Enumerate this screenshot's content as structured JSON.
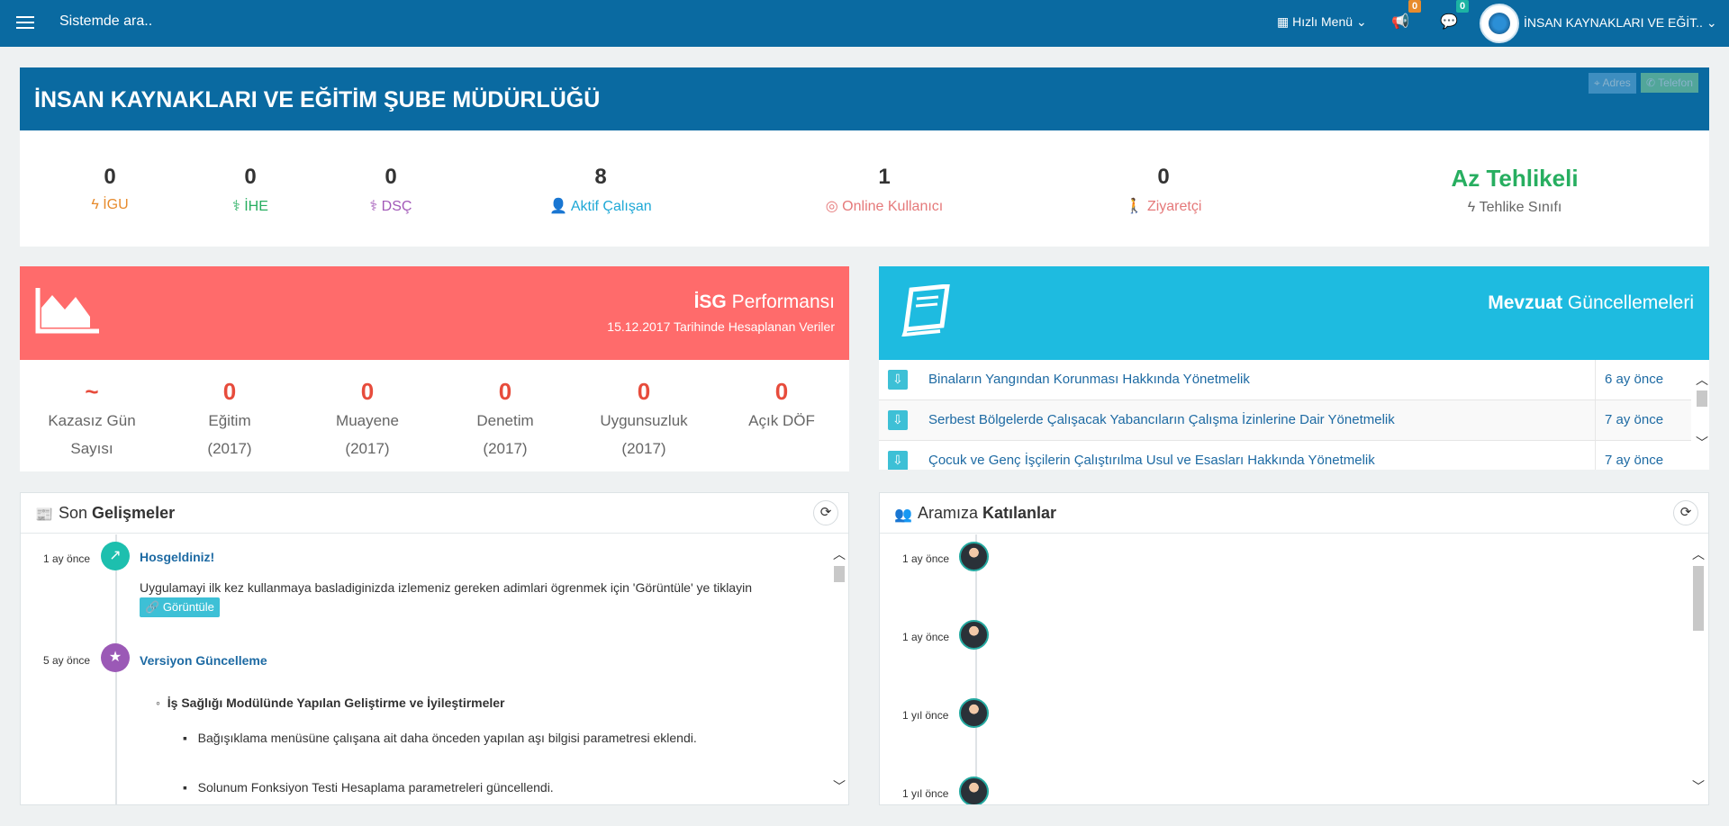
{
  "topbar": {
    "search_placeholder": "Sistemde ara..",
    "quick_menu": "Hızlı Menü",
    "notifications_count": "0",
    "messages_count": "0",
    "org_name": "İNSAN KAYNAKLARI VE EĞİT.."
  },
  "dept": {
    "title": "İNSAN KAYNAKLARI VE EĞİTİM ŞUBE MÜDÜRLÜĞÜ",
    "address_label": "Adres",
    "phone_label": "Telefon",
    "stats": [
      {
        "value": "0",
        "label": "İGU",
        "color": "#e78b2d"
      },
      {
        "value": "0",
        "label": "İHE",
        "color": "#27ae60"
      },
      {
        "value": "0",
        "label": "DSÇ",
        "color": "#a259b8"
      },
      {
        "value": "8",
        "label": "Aktif Çalışan",
        "color": "#1ea8d6"
      },
      {
        "value": "1",
        "label": "Online Kullanıcı",
        "color": "#e5797a"
      },
      {
        "value": "0",
        "label": "Ziyaretçi",
        "color": "#e5797a"
      },
      {
        "value": "Az Tehlikeli",
        "label": "Tehlike Sınıfı",
        "color": "#27ae60"
      }
    ]
  },
  "isg": {
    "title_bold": "İSG",
    "title_rest": " Performansı",
    "subtitle": "15.12.2017 Tarihinde Hesaplanan Veriler",
    "metrics": [
      {
        "value": "~",
        "line1": "Kazasız Gün",
        "line2": "Sayısı"
      },
      {
        "value": "0",
        "line1": "Eğitim",
        "line2": "(2017)"
      },
      {
        "value": "0",
        "line1": "Muayene",
        "line2": "(2017)"
      },
      {
        "value": "0",
        "line1": "Denetim",
        "line2": "(2017)"
      },
      {
        "value": "0",
        "line1": "Uygunsuzluk",
        "line2": "(2017)"
      },
      {
        "value": "0",
        "line1": "Açık DÖF",
        "line2": ""
      }
    ]
  },
  "mevzuat": {
    "title_bold": "Mevzuat",
    "title_rest": " Güncellemeleri",
    "rows": [
      {
        "name": "Binaların Yangından Korunması Hakkında Yönetmelik",
        "time": "6 ay önce"
      },
      {
        "name": "Serbest Bölgelerde Çalışacak Yabancıların Çalışma İzinlerine Dair Yönetmelik",
        "time": "7 ay önce"
      },
      {
        "name": "Çocuk ve Genç İşçilerin Çalıştırılma Usul ve Esasları Hakkında Yönetmelik",
        "time": "7 ay önce"
      }
    ]
  },
  "son": {
    "title_light": "Son ",
    "title_bold": "Gelişmeler",
    "items": [
      {
        "time": "1 ay önce",
        "title": "Hosgeldiniz!",
        "text": "Uygulamayi ilk kez kullanmaya basladiginizda izlemeniz gereken adimlari ögrenmek için 'Görüntüle' ye tiklayin",
        "button": "Görüntüle"
      },
      {
        "time": "5 ay önce",
        "title": "Versiyon Güncelleme",
        "heading": "İş Sağlığı Modülünde Yapılan Geliştirme ve İyileştirmeler",
        "bullets": [
          "Bağışıklama menüsüne çalışana ait daha önceden yapılan aşı bilgisi parametresi eklendi.",
          "Solunum Fonksiyon Testi Hesaplama parametreleri güncellendi."
        ]
      }
    ]
  },
  "aramiza": {
    "title_light": "Aramıza ",
    "title_bold": "Katılanlar",
    "items": [
      {
        "time": "1 ay önce"
      },
      {
        "time": "1 ay önce"
      },
      {
        "time": "1 yıl önce"
      },
      {
        "time": "1 yıl önce"
      }
    ]
  }
}
